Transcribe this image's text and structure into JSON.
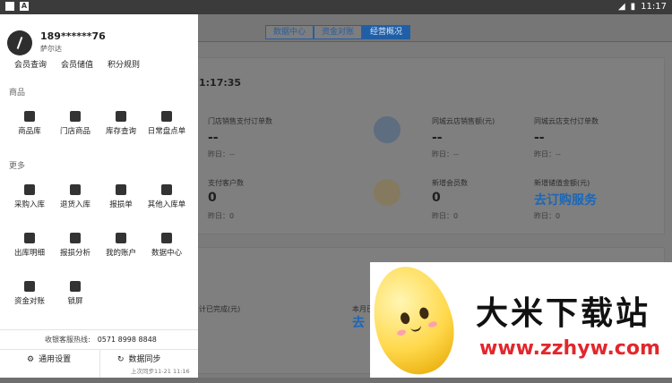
{
  "status_bar": {
    "time": "11:17",
    "battery": "▮"
  },
  "tabs": [
    {
      "label": "数据中心",
      "active": false
    },
    {
      "label": "资金对账",
      "active": false
    },
    {
      "label": "经营概况",
      "active": true
    }
  ],
  "dashboard": {
    "time": "1:17:35",
    "stats": [
      {
        "title": "门店销售支付订单数",
        "value": "--",
        "sub": "昨日：--"
      },
      {
        "title": "同城云店销售额(元)",
        "value": "--",
        "sub": "昨日：--"
      },
      {
        "title": "同城云店支付订单数",
        "value": "--",
        "sub": "昨日：--"
      },
      {
        "title": "支付客户数",
        "value": "0",
        "sub": "昨日：0"
      },
      {
        "title": "新增会员数",
        "value": "0",
        "sub": "昨日：0"
      },
      {
        "title": "新增储值金额(元)",
        "value": "去订购服务",
        "sub": "昨日：0"
      }
    ],
    "lower_left": "计已完成(元)",
    "lower_mid": "本月已",
    "lower_link": "去"
  },
  "drawer": {
    "phone": "189******76",
    "store": "萨尔达",
    "top_links": [
      "会员查询",
      "会员储值",
      "积分规则"
    ],
    "section_goods": "商品",
    "goods": [
      "商品库",
      "门店商品",
      "库存查询",
      "日常盘点单"
    ],
    "section_more": "更多",
    "more": [
      "采购入库",
      "退货入库",
      "报损单",
      "其他入库单",
      "出库明细",
      "报损分析",
      "我的账户",
      "数据中心",
      "资金对账",
      "锁屏"
    ],
    "hotline_label": "收银客服热线:",
    "hotline_number": "0571 8998 8848",
    "settings": "通用设置",
    "sync": "数据同步",
    "sync_sub": "上次同步11-21 11:16"
  },
  "watermark": {
    "name": "大米下载站",
    "url": "www.zzhyw.com"
  }
}
